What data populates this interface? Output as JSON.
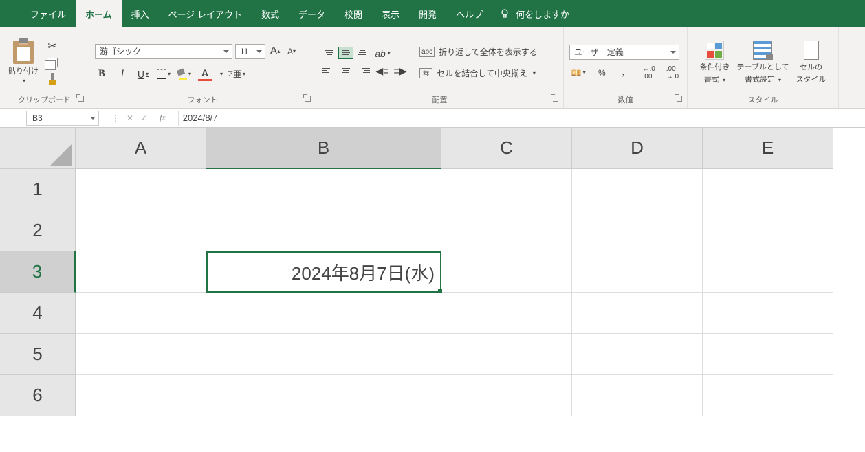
{
  "tabs": {
    "file": "ファイル",
    "home": "ホーム",
    "insert": "挿入",
    "pageLayout": "ページ レイアウト",
    "formulas": "数式",
    "data": "データ",
    "review": "校閲",
    "view": "表示",
    "developer": "開発",
    "help": "ヘルプ",
    "tellme": "何をしますか"
  },
  "ribbon": {
    "clipboard": {
      "paste": "貼り付け",
      "label": "クリップボード"
    },
    "font": {
      "name": "游ゴシック",
      "size": "11",
      "label": "フォント",
      "grow": "A",
      "shrink": "A",
      "bold": "B",
      "italic": "I",
      "underline": "U",
      "color": "A",
      "ruby": "ア",
      "rubySup": "亜"
    },
    "alignment": {
      "wrap": "折り返して全体を表示する",
      "merge": "セルを結合して中央揃え",
      "label": "配置",
      "abc": "abc"
    },
    "number": {
      "format": "ユーザー定義",
      "label": "数値",
      "pct": "%",
      "comma": "，",
      "dec": ".0",
      "dec2": ".00"
    },
    "styles": {
      "cond": "条件付き\n書式",
      "condL1": "条件付き",
      "condL2": "書式",
      "table": "テーブルとして\n書式設定",
      "tableL1": "テーブルとして",
      "tableL2": "書式設定",
      "cell": "セルの\nスタイル",
      "cellL1": "セルの",
      "cellL2": "スタイル",
      "label": "スタイル"
    }
  },
  "nameBox": "B3",
  "formula": "2024/8/7",
  "cols": [
    "A",
    "B",
    "C",
    "D",
    "E"
  ],
  "rows": [
    "1",
    "2",
    "3",
    "4",
    "5",
    "6"
  ],
  "cellB3": "2024年8月7日(水)"
}
